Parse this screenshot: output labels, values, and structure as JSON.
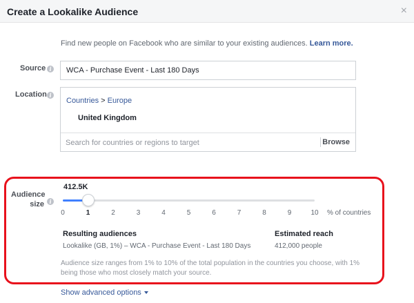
{
  "dialog": {
    "title": "Create a Lookalike Audience",
    "close_glyph": "×"
  },
  "intro": {
    "text": "Find new people on Facebook who are similar to your existing audiences.",
    "learn_more": "Learn more."
  },
  "source": {
    "label": "Source",
    "value": "WCA - Purchase Event - Last 180 Days"
  },
  "location": {
    "label": "Location",
    "breadcrumb": [
      "Countries",
      ">",
      "Europe"
    ],
    "selected_country": "United Kingdom",
    "search_placeholder": "Search for countries or regions to target",
    "browse_label": "Browse"
  },
  "audience_size": {
    "label_line1": "Audience",
    "label_line2": "size",
    "reach_value": "412.5K",
    "slider_value": 1,
    "slider_max": 10,
    "ticks": [
      "0",
      "1",
      "2",
      "3",
      "4",
      "5",
      "6",
      "7",
      "8",
      "9",
      "10"
    ],
    "unit_label": "% of countries",
    "resulting_header": "Resulting audiences",
    "resulting_value": "Lookalike (GB, 1%) – WCA - Purchase Event - Last 180 Days",
    "reach_header": "Estimated reach",
    "reach_people": "412,000 people",
    "note": "Audience size ranges from 1% to 10% of the total population in the countries you choose, with 1% being those who most closely match your source."
  },
  "advanced": {
    "label": "Show advanced options"
  },
  "colors": {
    "link": "#365899",
    "highlight": "#e8111c",
    "slider_fill": "#4080ff"
  }
}
